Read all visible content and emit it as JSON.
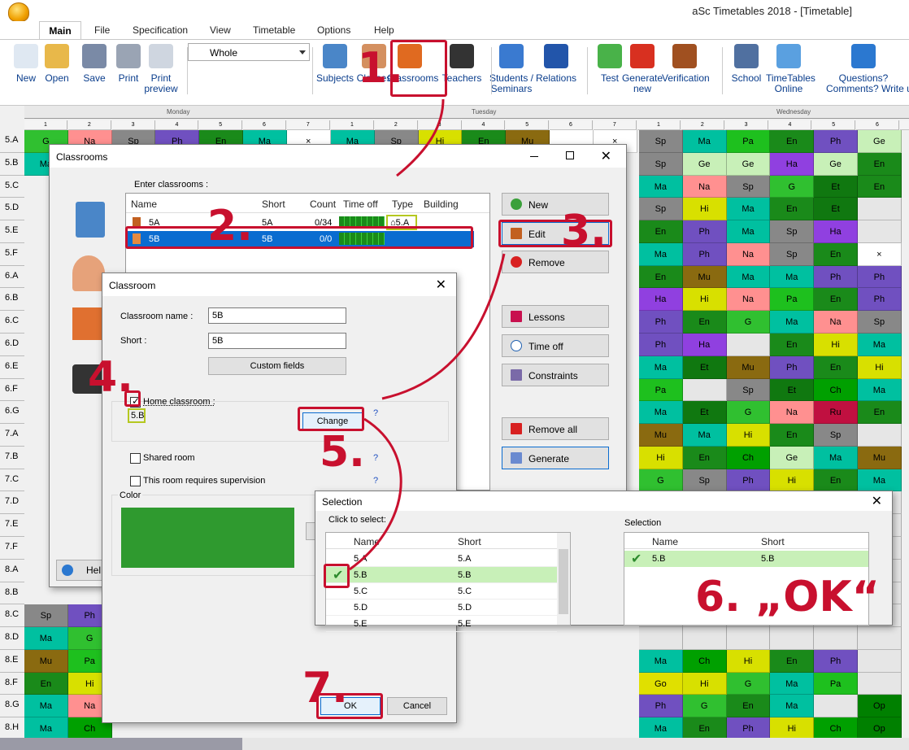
{
  "window": {
    "title": "aSc Timetables 2018  - [Timetable]"
  },
  "menu": [
    "Main",
    "File",
    "Specification",
    "View",
    "Timetable",
    "Options",
    "Help"
  ],
  "ribbon": {
    "buttons": [
      {
        "label": "New",
        "color": "#dfe8f2"
      },
      {
        "label": "Open",
        "color": "#e8b84a"
      },
      {
        "label": "Save",
        "color": "#7a8aa6"
      },
      {
        "label": "Print",
        "color": "#9aa4b4"
      },
      {
        "label": "Print\npreview",
        "color": "#cfd6e0"
      },
      {
        "label": "Subjects",
        "color": "#4a86c8"
      },
      {
        "label": "Classes",
        "color": "#d49060"
      },
      {
        "label": "Classrooms",
        "color": "#e06a20"
      },
      {
        "label": "Teachers",
        "color": "#333"
      },
      {
        "label": "Students /\nSeminars",
        "color": "#3a7ad0"
      },
      {
        "label": "Relations",
        "color": "#2255aa"
      },
      {
        "label": "Test",
        "color": "#49b249"
      },
      {
        "label": "Generate\nnew",
        "color": "#d83020"
      },
      {
        "label": "Verification",
        "color": "#a05020"
      },
      {
        "label": "School",
        "color": "#5070a0"
      },
      {
        "label": "TimeTables\nOnline",
        "color": "#5aa0e0"
      },
      {
        "label": "Questions?\nComments? Write us",
        "color": "#2b78d0"
      }
    ],
    "view_select": "Whole"
  },
  "grid": {
    "days": [
      "Monday",
      "Tuesday",
      "Wednesday"
    ],
    "periods": [
      "1",
      "2",
      "3",
      "4",
      "5",
      "6",
      "7"
    ],
    "rows": [
      "5.A",
      "5.B",
      "5.C",
      "5.D",
      "5.E",
      "5.F",
      "6.A",
      "6.B",
      "6.C",
      "6.D",
      "6.E",
      "6.F",
      "6.G",
      "7.A",
      "7.B",
      "7.C",
      "7.D",
      "7.E",
      "7.F",
      "8.A",
      "8.B",
      "8.C",
      "8.D",
      "8.E",
      "8.F",
      "8.G",
      "8.H"
    ],
    "right_cells": [
      [
        "Sp",
        "Ma",
        "Pa",
        "En",
        "Ph",
        "Ge"
      ],
      [
        "Sp",
        "Ge",
        "Ge",
        "Ha",
        "Ge",
        "En"
      ],
      [
        "Ma",
        "Na",
        "Sp",
        "G",
        "Et",
        "En"
      ],
      [
        "Sp",
        "Hi",
        "Ma",
        "En",
        "Et",
        ""
      ],
      [
        "En",
        "Ph",
        "Ma",
        "Sp",
        "Ha",
        ""
      ],
      [
        "Ma",
        "Ph",
        "Na",
        "Sp",
        "En",
        "×"
      ],
      [
        "En",
        "Mu",
        "Ma",
        "Ma",
        "Ph",
        "Ph"
      ],
      [
        "Ha",
        "Hi",
        "Na",
        "Pa",
        "En",
        "Ph"
      ],
      [
        "Ph",
        "En",
        "G",
        "Ma",
        "Na",
        "Sp"
      ],
      [
        "Ph",
        "Ha",
        "",
        "En",
        "Hi",
        "Ma"
      ],
      [
        "Ma",
        "Et",
        "Mu",
        "Ph",
        "En",
        "Hi"
      ],
      [
        "Pa",
        "",
        "Sp",
        "Et",
        "Ch",
        "Ma"
      ],
      [
        "Ma",
        "Et",
        "G",
        "Na",
        "Ru",
        "En"
      ],
      [
        "Mu",
        "Ma",
        "Hi",
        "En",
        "Sp",
        ""
      ],
      [
        "Hi",
        "En",
        "Ch",
        "Ge",
        "Ma",
        "Mu"
      ],
      [
        "G",
        "Sp",
        "Ph",
        "Hi",
        "En",
        "Ma"
      ],
      [
        "Ch",
        "En",
        "",
        "",
        "Ge",
        ""
      ],
      [
        "",
        "",
        "",
        "",
        "",
        ""
      ],
      [
        "",
        "",
        "",
        "",
        "",
        ""
      ],
      [
        "",
        "",
        "",
        "",
        "",
        ""
      ],
      [
        "",
        "",
        "",
        "",
        "",
        ""
      ],
      [
        "",
        "",
        "",
        "",
        "",
        ""
      ],
      [
        "",
        "",
        "",
        "",
        "",
        ""
      ],
      [
        "Ma",
        "Ch",
        "Hi",
        "En",
        "Ph",
        ""
      ],
      [
        "Go",
        "Hi",
        "G",
        "Ma",
        "Pa",
        ""
      ],
      [
        "Ph",
        "G",
        "En",
        "Ma",
        "",
        "Op"
      ],
      [
        "Ma",
        "En",
        "Ph",
        "Hi",
        "Ch",
        "Op"
      ]
    ],
    "left_cells": [
      [
        "G",
        "Na",
        "Sp",
        "Ph",
        "En",
        "Ma",
        "×"
      ],
      [
        "Ma",
        "Ph",
        "Ge",
        "",
        "",
        "",
        ""
      ]
    ],
    "bottom_left": [
      [
        "Sp",
        "Ph"
      ],
      [
        "Ma",
        "G"
      ],
      [
        "Mu",
        "Pa"
      ],
      [
        "En",
        "Hi"
      ],
      [
        "Ma",
        "Na"
      ],
      [
        "Ma",
        "Ch"
      ]
    ],
    "tuesday_row1": [
      "Ma",
      "Sp",
      "Hi",
      "En",
      "Mu",
      "",
      "×"
    ]
  },
  "classrooms_dialog": {
    "title": "Classrooms",
    "enter_label": "Enter classrooms :",
    "columns": [
      "Name",
      "Short",
      "Count",
      "Time off",
      "Type",
      "Building"
    ],
    "rows": [
      {
        "name": "5A",
        "short": "5A",
        "count": "0/34",
        "type": "5.A"
      },
      {
        "name": "5B",
        "short": "5B",
        "count": "0/0",
        "type": ""
      }
    ],
    "buttons": [
      "New",
      "Edit",
      "Remove",
      "Lessons",
      "Time off",
      "Constraints",
      "Remove all",
      "Generate"
    ],
    "help": "Hel"
  },
  "classroom_dialog": {
    "title": "Classroom",
    "name_label": "Classroom name :",
    "name_value": "5B",
    "short_label": "Short :",
    "short_value": "5B",
    "custom_fields": "Custom fields",
    "home_classroom": "Home classroom :",
    "home_value": "5.B",
    "change": "Change",
    "shared_room": "Shared room",
    "supervision": "This room requires supervision",
    "color_label": "Color",
    "color": "#2f9a2f",
    "ok": "OK",
    "cancel": "Cancel",
    "q": "?"
  },
  "selection_dialog": {
    "title": "Selection",
    "click_label": "Click to select:",
    "selection_label": "Selection",
    "columns": [
      "Name",
      "Short"
    ],
    "items": [
      {
        "name": "5.A",
        "short": "5.A"
      },
      {
        "name": "5.B",
        "short": "5.B"
      },
      {
        "name": "5.C",
        "short": "5.C"
      },
      {
        "name": "5.D",
        "short": "5.D"
      },
      {
        "name": "5.E",
        "short": "5.E"
      }
    ],
    "selected": [
      {
        "name": "5.B",
        "short": "5.B"
      }
    ]
  },
  "annotations": [
    "1.",
    "2.",
    "3.",
    "4.",
    "5.",
    "6. „OK“",
    "7."
  ]
}
